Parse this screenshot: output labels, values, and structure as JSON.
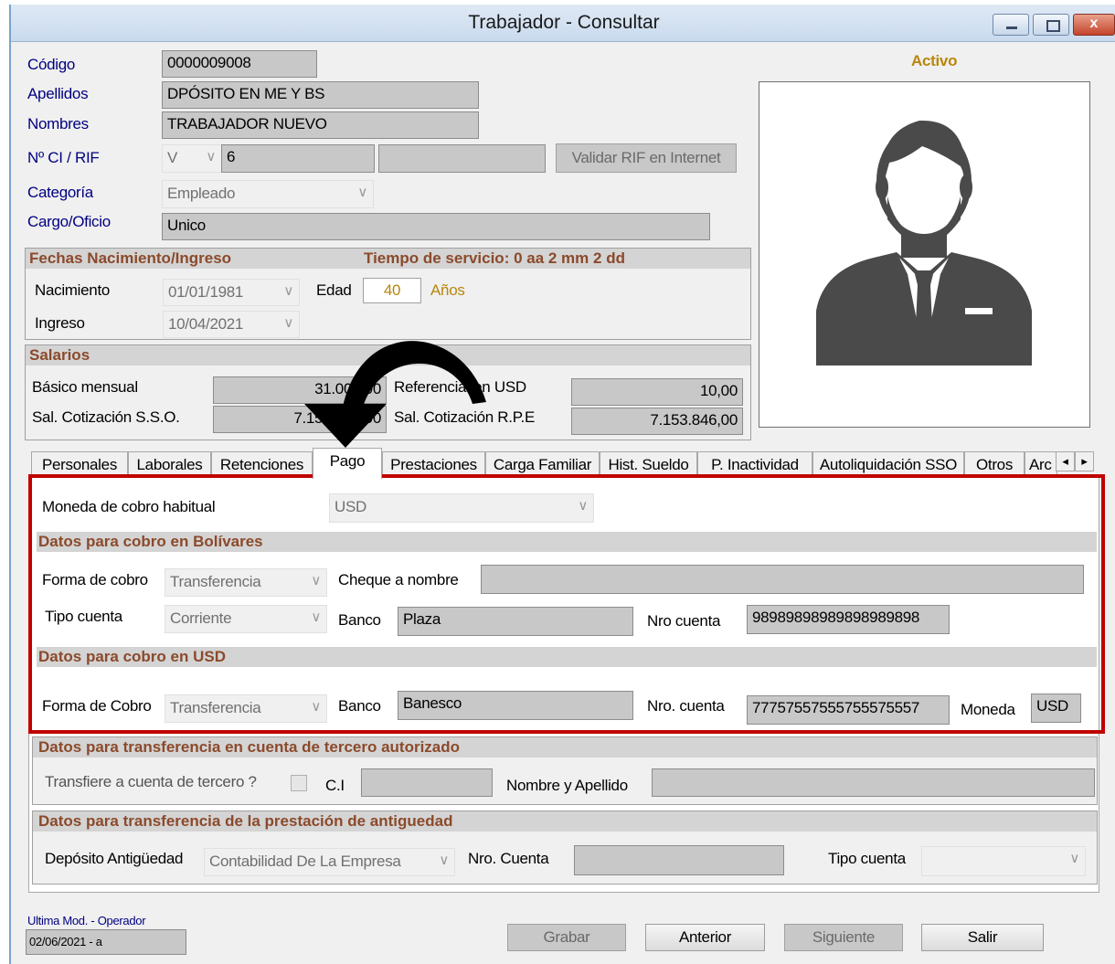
{
  "window": {
    "title": "Trabajador - Consultar",
    "status": "Activo"
  },
  "personal": {
    "codigo_label": "Código",
    "codigo": "0000009008",
    "apellidos_label": "Apellidos",
    "apellidos": "DPÓSITO EN ME Y BS",
    "nombres_label": "Nombres",
    "nombres": "TRABAJADOR NUEVO",
    "ci_label": "Nº CI / RIF",
    "ci_tipo": "V",
    "ci_numero": "6",
    "ci_extra": "",
    "validar_button": "Validar RIF en Internet",
    "categoria_label": "Categoría",
    "categoria": "Empleado",
    "cargo_label": "Cargo/Oficio",
    "cargo": "Unico"
  },
  "fechas": {
    "title": "Fechas Nacimiento/Ingreso",
    "tiempo_servicio": "Tiempo de servicio: 0 aa 2 mm 2 dd",
    "nacimiento_label": "Nacimiento",
    "nacimiento": "01/01/1981",
    "edad_label": "Edad",
    "edad": "40",
    "anios_label": "Años",
    "ingreso_label": "Ingreso",
    "ingreso": "10/04/2021"
  },
  "salarios": {
    "title": "Salarios",
    "basico_label": "Básico mensual",
    "basico": "31.000,00",
    "referencial_label": "Referencial en USD",
    "referencial": "10,00",
    "sso_label": "Sal. Cotización S.S.O.",
    "sso": "7.153.846,00",
    "rpe_label": "Sal. Cotización R.P.E",
    "rpe": "7.153.846,00"
  },
  "tabs": [
    {
      "label": "Personales"
    },
    {
      "label": "Laborales"
    },
    {
      "label": "Retenciones"
    },
    {
      "label": "Pago"
    },
    {
      "label": "Prestaciones"
    },
    {
      "label": "Carga Familiar"
    },
    {
      "label": "Hist. Sueldo"
    },
    {
      "label": "P.  Inactividad"
    },
    {
      "label": "Autoliquidación SSO"
    },
    {
      "label": "Otros"
    },
    {
      "label": "Arc"
    }
  ],
  "active_tab": "Pago",
  "pago": {
    "moneda_label": "Moneda de cobro habitual",
    "moneda": "USD",
    "bolivares_title": "Datos para cobro en Bolívares",
    "forma_cobro_label": "Forma de cobro",
    "forma_cobro": "Transferencia",
    "cheque_label": "Cheque a nombre",
    "cheque": "",
    "tipo_cuenta_label": "Tipo cuenta",
    "tipo_cuenta": "Corriente",
    "banco_label": "Banco",
    "banco": "Plaza",
    "nro_cuenta_label": "Nro cuenta",
    "nro_cuenta": "98989898989898989898",
    "usd_title": "Datos para cobro en USD",
    "usd_forma_label": "Forma de Cobro",
    "usd_forma": "Transferencia",
    "usd_banco_label": "Banco",
    "usd_banco": "Banesco",
    "usd_nro_label": "Nro. cuenta",
    "usd_nro": "77757557555755575557",
    "usd_moneda_label": "Moneda",
    "usd_moneda": "USD"
  },
  "tercero": {
    "title": "Datos para transferencia en cuenta de tercero autorizado",
    "transfiere_label": "Transfiere a cuenta de tercero ?",
    "ci_label": "C.I",
    "ci": "",
    "nombre_label": "Nombre y Apellido",
    "nombre": ""
  },
  "antiguedad": {
    "title": "Datos para transferencia de la prestación de antiguedad",
    "deposito_label": "Depósito Antigüedad",
    "deposito": "Contabilidad De La Empresa",
    "nro_cuenta_label": "Nro. Cuenta",
    "nro_cuenta": "",
    "tipo_cuenta_label": "Tipo cuenta",
    "tipo_cuenta": ""
  },
  "footer": {
    "ultima_mod_label": "Ultima Mod. - Operador",
    "ultima_mod": "02/06/2021 - a",
    "grabar": "Grabar",
    "anterior": "Anterior",
    "siguiente": "Siguiente",
    "salir": "Salir"
  },
  "icons": {
    "tab_scroll_left": "◂",
    "tab_scroll_right": "▸",
    "dropdown": "∨",
    "close": "x"
  },
  "colors": {
    "section_title": "#8b4a2b",
    "highlight_box": "#c00000",
    "status": "#b8860b",
    "avatar": "#4a4a4a"
  }
}
